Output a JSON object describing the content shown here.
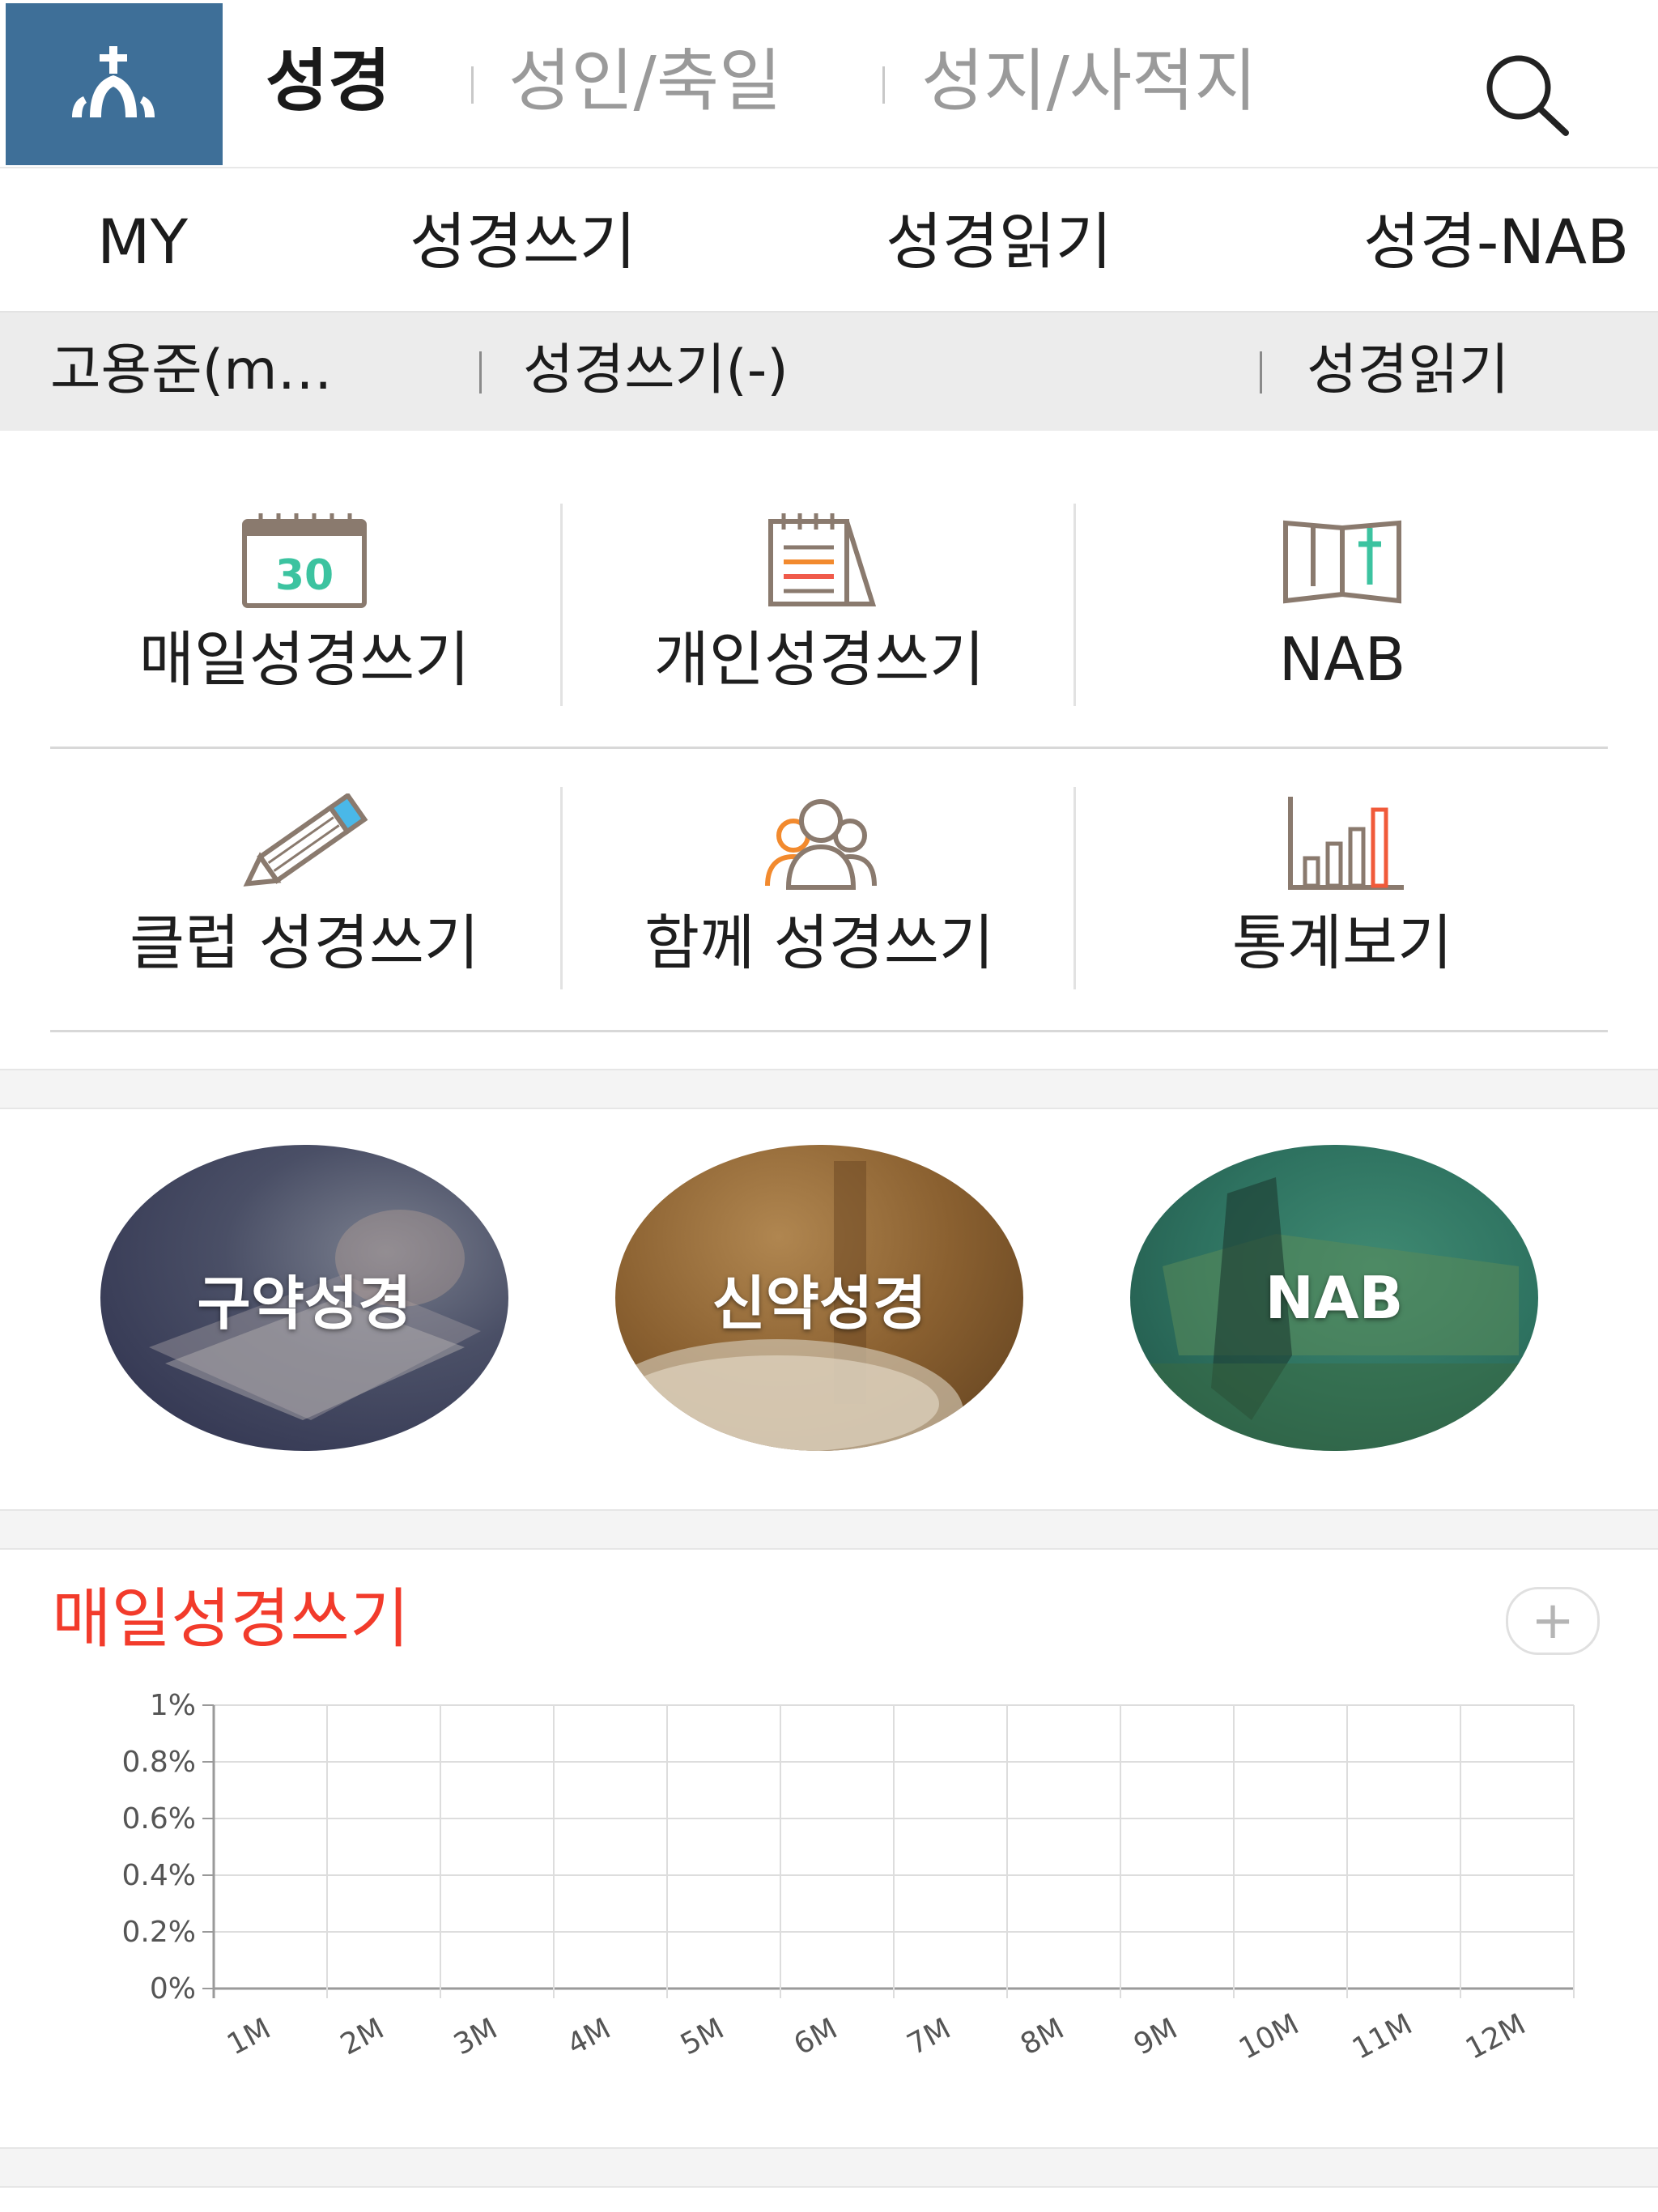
{
  "header": {
    "tabs": [
      {
        "label": "성경",
        "active": true
      },
      {
        "label": "성인/축일",
        "active": false
      },
      {
        "label": "성지/사적지",
        "active": false
      }
    ],
    "logo_icon": "church-icon",
    "search_icon": "search-icon"
  },
  "nav2": {
    "items": [
      "MY",
      "성경쓰기",
      "성경읽기",
      "성경-NAB"
    ]
  },
  "nav3": {
    "user": "고용준(m…",
    "writing": "성경쓰기(-)",
    "reading": "성경읽기"
  },
  "menu": {
    "items": [
      {
        "label": "매일성경쓰기",
        "icon": "calendar-30-icon",
        "calendar_day": "30"
      },
      {
        "label": "개인성경쓰기",
        "icon": "notepad-icon"
      },
      {
        "label": "NAB",
        "icon": "bible-book-icon"
      },
      {
        "label": "클럽 성경쓰기",
        "icon": "pencil-icon"
      },
      {
        "label": "함께 성경쓰기",
        "icon": "people-group-icon"
      },
      {
        "label": "통계보기",
        "icon": "bar-chart-icon"
      }
    ]
  },
  "bible_circles": [
    {
      "label": "구약성경"
    },
    {
      "label": "신약성경"
    },
    {
      "label": "NAB"
    }
  ],
  "daily_section": {
    "title": "매일성경쓰기",
    "plus_label": "+"
  },
  "colors": {
    "brand": "#3e6f98",
    "accent_red": "#f23b2b",
    "icon_green": "#3cc3a0",
    "icon_orange": "#f28a2e",
    "icon_blue": "#4ab8e8"
  },
  "chart_data": {
    "type": "line",
    "categories": [
      "1M",
      "2M",
      "3M",
      "4M",
      "5M",
      "6M",
      "7M",
      "8M",
      "9M",
      "10M",
      "11M",
      "12M"
    ],
    "series": [],
    "yticks": [
      "0%",
      "0.2%",
      "0.4%",
      "0.6%",
      "0.8%",
      "1%"
    ],
    "ylim": [
      0,
      1
    ],
    "grid": true,
    "title": "",
    "xlabel": "",
    "ylabel": ""
  }
}
